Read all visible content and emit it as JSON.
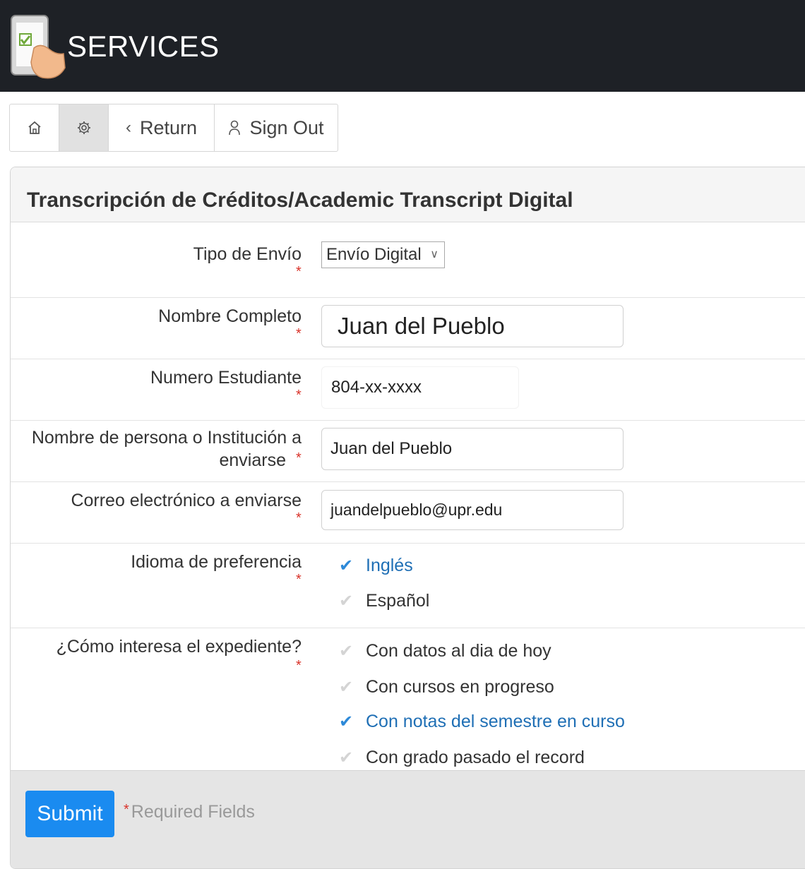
{
  "header": {
    "title": "SERVICES",
    "logo_icon": "tablet-checklist-hand-icon"
  },
  "toolbar": {
    "home_icon": "home-icon",
    "settings_icon": "gear-icon",
    "return_label": "Return",
    "signout_label": "Sign Out"
  },
  "form": {
    "title": "Transcripción de Créditos/Academic Transcript Digital",
    "required_marker": "*",
    "tipo_envio": {
      "label": "Tipo de Envío",
      "value": "Envío Digital"
    },
    "nombre_completo": {
      "label": "Nombre Completo",
      "value": "Juan del Pueblo"
    },
    "numero_estudiante": {
      "label": "Numero Estudiante",
      "value": "804-xx-xxxx"
    },
    "destinatario": {
      "label_line1": "Nombre de persona o Institución a",
      "label_line2": "enviarse",
      "value": "Juan del Pueblo"
    },
    "correo": {
      "label": "Correo electrónico a enviarse",
      "value": "juandelpueblo@upr.edu"
    },
    "idioma": {
      "label": "Idioma de preferencia",
      "options": [
        {
          "label": "Inglés",
          "checked": true
        },
        {
          "label": "Español",
          "checked": false
        }
      ]
    },
    "expediente": {
      "label": "¿Cómo interesa el expediente?",
      "options": [
        {
          "label": "Con datos al dia de hoy",
          "checked": false
        },
        {
          "label": "Con cursos en progreso",
          "checked": false
        },
        {
          "label": "Con notas del semestre en curso",
          "checked": true
        },
        {
          "label": "Con grado pasado el record",
          "checked": false
        }
      ]
    }
  },
  "footer": {
    "submit_label": "Submit",
    "required_note": "Required Fields"
  },
  "colors": {
    "header_bg": "#1e2126",
    "accent": "#1a8bf0",
    "required": "#d9342b",
    "checked": "#2d89d8"
  }
}
